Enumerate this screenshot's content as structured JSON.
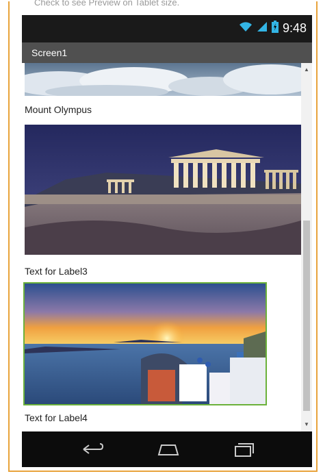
{
  "caption": "Check to see Preview on Tablet size.",
  "statusbar": {
    "time": "9:48",
    "icons": [
      "wifi-icon",
      "signal-icon",
      "battery-icon"
    ]
  },
  "app": {
    "title": "Screen1"
  },
  "items": [
    {
      "label": "Mount Olympus",
      "image": "clouds-image"
    },
    {
      "label": "Text for Label3",
      "image": "acropolis-image"
    },
    {
      "label": "Text for Label4",
      "image": "santorini-sunset-image"
    }
  ],
  "navbar": {
    "icons": [
      "back-icon",
      "home-icon",
      "recent-apps-icon"
    ]
  },
  "colors": {
    "frame_border": "#e8a33a",
    "titlebar": "#505050",
    "status_icon": "#33b5e5",
    "image_highlight": "#6bb13a"
  }
}
